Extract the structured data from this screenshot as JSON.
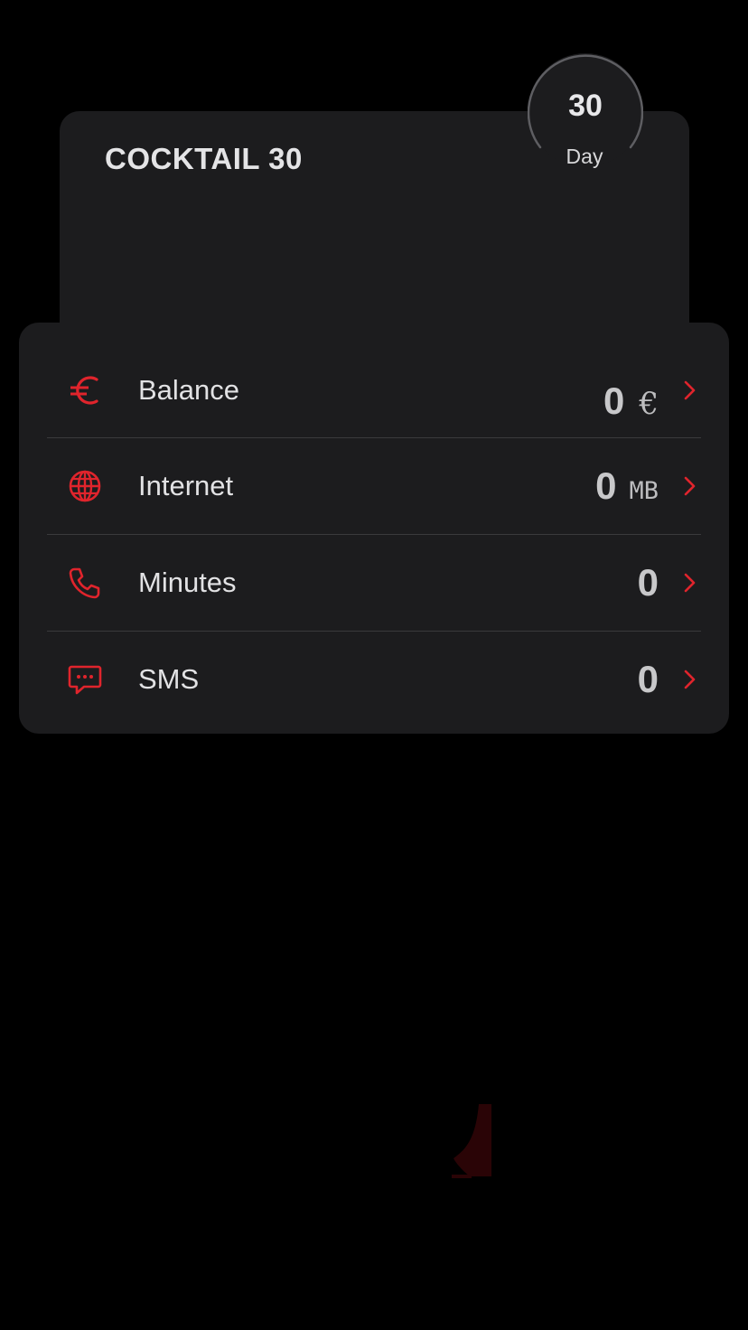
{
  "theme": {
    "accent": "#e0242c",
    "background": "#000000",
    "card": "#1c1c1e"
  },
  "plan": {
    "name": "COCKTAIL 30",
    "days_value": "30",
    "days_unit": "Day"
  },
  "usage": {
    "rows": [
      {
        "label": "Balance",
        "value": "0",
        "unit": "€",
        "icon": "euro-icon"
      },
      {
        "label": "Internet",
        "value": "0",
        "unit": "MB",
        "icon": "globe-icon"
      },
      {
        "label": "Minutes",
        "value": "0",
        "unit": "",
        "icon": "phone-icon"
      },
      {
        "label": "SMS",
        "value": "0",
        "unit": "",
        "icon": "chat-bubble-icon"
      }
    ]
  }
}
